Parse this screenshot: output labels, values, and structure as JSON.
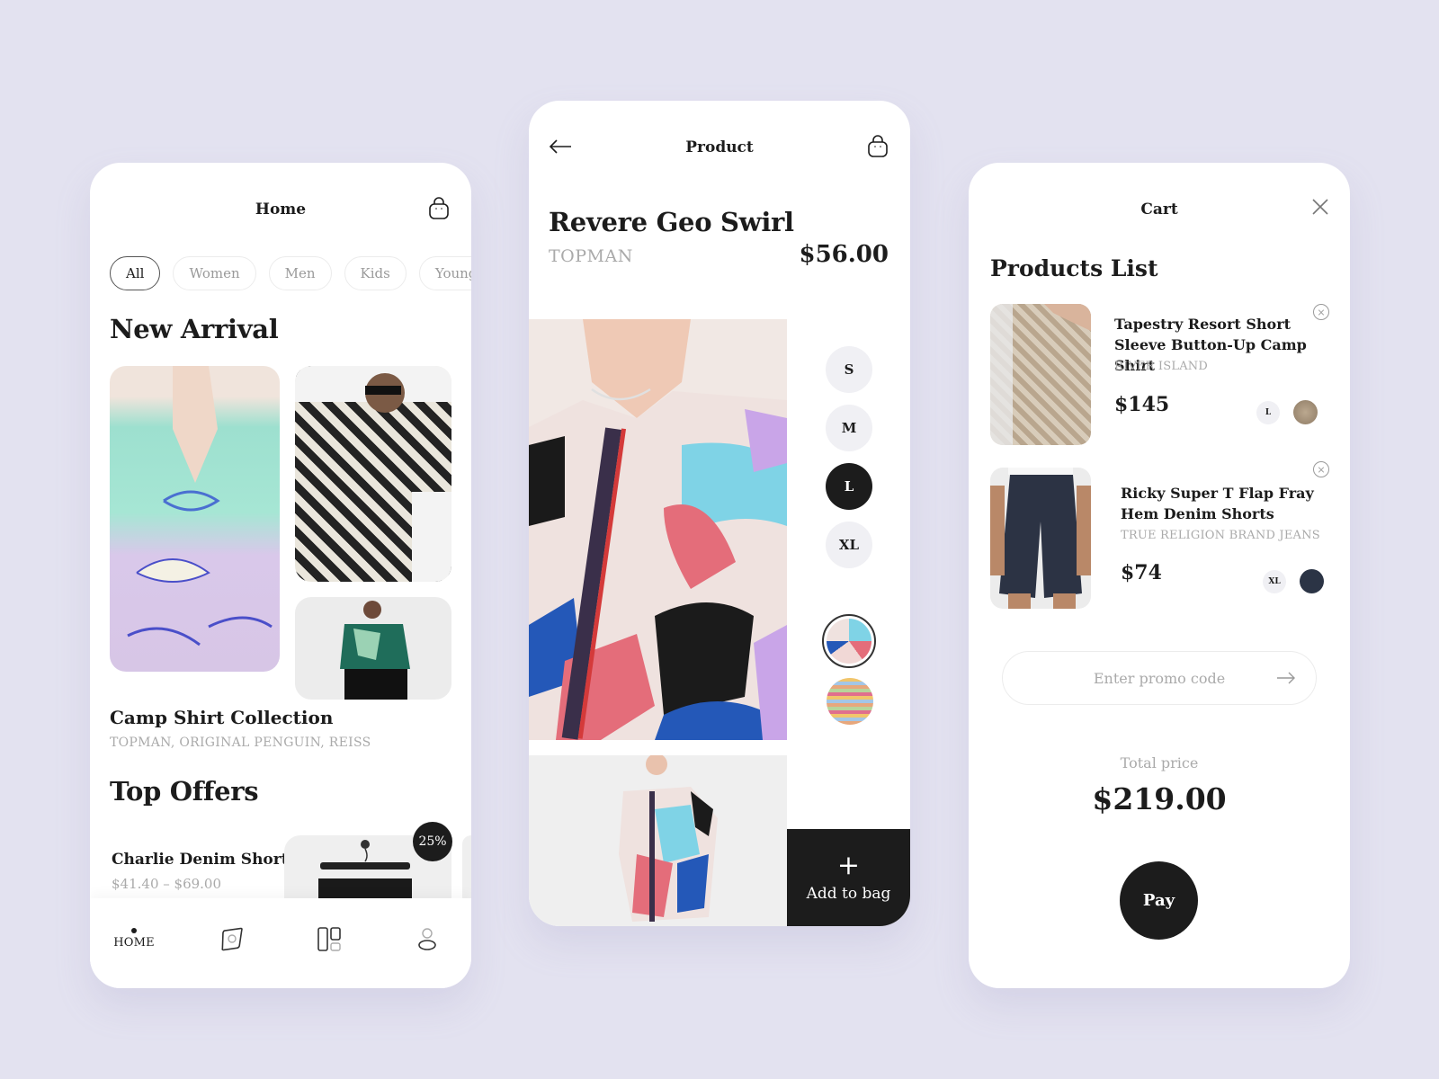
{
  "colors": {
    "background": "#e3e2f0",
    "dark": "#1c1c1c",
    "muted": "#aaaaaa",
    "chip_border": "#ececec",
    "size_bg": "#f0f0f4"
  },
  "home": {
    "title": "Home",
    "cart_icon": "shopping-bag-icon",
    "categories": [
      {
        "label": "All",
        "active": true
      },
      {
        "label": "Women",
        "active": false
      },
      {
        "label": "Men",
        "active": false
      },
      {
        "label": "Kids",
        "active": false
      },
      {
        "label": "Young",
        "active": false
      }
    ],
    "new_arrival": {
      "heading": "New Arrival",
      "collection_title": "Camp Shirt Collection",
      "collection_brands": "TOPMAN, ORIGINAL PENGUIN, REISS"
    },
    "top_offers": {
      "heading": "Top Offers",
      "items": [
        {
          "name": "Charlie Denim Short",
          "price_range": "$41.40 – $69.00",
          "discount": "25%"
        }
      ]
    },
    "tabbar": [
      {
        "label": "HOME",
        "icon": "home-dot-icon",
        "active": true
      },
      {
        "label": "",
        "icon": "discover-icon",
        "active": false
      },
      {
        "label": "",
        "icon": "catalog-icon",
        "active": false
      },
      {
        "label": "",
        "icon": "profile-icon",
        "active": false
      }
    ]
  },
  "product": {
    "title": "Product",
    "name": "Revere Geo Swirl",
    "brand": "TOPMAN",
    "price": "$56.00",
    "sizes": [
      {
        "label": "S",
        "selected": false
      },
      {
        "label": "M",
        "selected": false
      },
      {
        "label": "L",
        "selected": true
      },
      {
        "label": "XL",
        "selected": false
      }
    ],
    "colors": [
      {
        "name": "geo-swirl",
        "selected": true
      },
      {
        "name": "zigzag",
        "selected": false
      }
    ],
    "add_to_bag": {
      "icon": "+",
      "label": "Add to bag"
    }
  },
  "cart": {
    "title": "Cart",
    "heading": "Products List",
    "items": [
      {
        "name_line1": "Tapestry Resort Short",
        "name_line2": "Sleeve Button-Up Camp Shirt",
        "brand": "RIVER ISLAND",
        "price": "$145",
        "size": "L",
        "color": "#a59580"
      },
      {
        "name_line1": "Ricky Super T Flap Fray",
        "name_line2": "Hem Denim Shorts",
        "brand": "TRUE RELIGION BRAND JEANS",
        "price": "$74",
        "size": "XL",
        "color": "#2b3445"
      }
    ],
    "remove_icon": "×",
    "promo": {
      "placeholder": "Enter promo code",
      "value": ""
    },
    "total_label": "Total price",
    "total_value": "$219.00",
    "pay_label": "Pay"
  }
}
